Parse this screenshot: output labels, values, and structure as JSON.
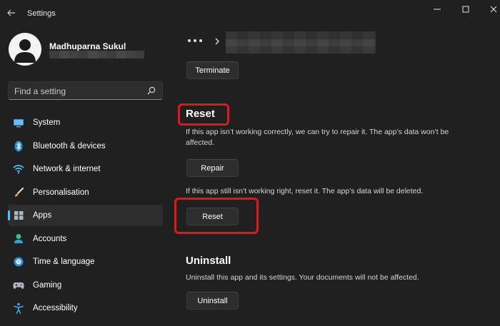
{
  "window": {
    "title": "Settings"
  },
  "profile": {
    "name": "Madhuparna Sukul"
  },
  "search": {
    "placeholder": "Find a setting"
  },
  "sidebar": {
    "items": [
      {
        "label": "System",
        "icon": "monitor-icon",
        "selected": false
      },
      {
        "label": "Bluetooth & devices",
        "icon": "bluetooth-icon",
        "selected": false
      },
      {
        "label": "Network & internet",
        "icon": "wifi-icon",
        "selected": false
      },
      {
        "label": "Personalisation",
        "icon": "brush-icon",
        "selected": false
      },
      {
        "label": "Apps",
        "icon": "apps-icon",
        "selected": true
      },
      {
        "label": "Accounts",
        "icon": "person-icon",
        "selected": false
      },
      {
        "label": "Time & language",
        "icon": "globe-clock-icon",
        "selected": false
      },
      {
        "label": "Gaming",
        "icon": "gamepad-icon",
        "selected": false
      },
      {
        "label": "Accessibility",
        "icon": "accessibility-icon",
        "selected": false
      }
    ]
  },
  "main": {
    "terminate_label": "Terminate",
    "reset_section": {
      "heading": "Reset",
      "repair_description": "If this app isn’t working correctly, we can try to repair it. The app’s data won’t be affected.",
      "repair_label": "Repair",
      "reset_description": "If this app still isn’t working right, reset it. The app’s data will be deleted.",
      "reset_label": "Reset"
    },
    "uninstall_section": {
      "heading": "Uninstall",
      "description": "Uninstall this app and its settings. Your documents will not be affected.",
      "uninstall_label": "Uninstall"
    }
  },
  "colors": {
    "background": "#202020",
    "accent": "#4cc2ff",
    "highlight": "#e8141c"
  }
}
